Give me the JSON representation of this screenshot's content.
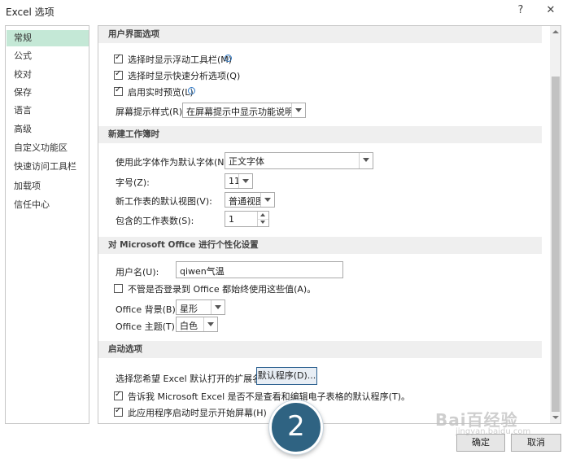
{
  "window": {
    "title": "Excel 选项",
    "help": "?",
    "close": "✕"
  },
  "sidebar": {
    "items": [
      {
        "label": "常规",
        "selected": true
      },
      {
        "label": "公式"
      },
      {
        "label": "校对"
      },
      {
        "label": "保存"
      },
      {
        "label": "语言"
      },
      {
        "label": "高级"
      },
      {
        "label": "自定义功能区"
      },
      {
        "label": "快速访问工具栏"
      },
      {
        "label": "加载项"
      },
      {
        "label": "信任中心"
      }
    ]
  },
  "ui_options": {
    "header": "用户界面选项",
    "show_mini_toolbar": {
      "label": "选择时显示浮动工具栏(M)",
      "checked": true
    },
    "show_quick_analysis": {
      "label": "选择时显示快速分析选项(Q)",
      "checked": true
    },
    "live_preview": {
      "label": "启用实时预览(L)",
      "checked": true
    },
    "screentip_style": {
      "label": "屏幕提示样式(R):",
      "value": "在屏幕提示中显示功能说明"
    }
  },
  "new_workbook": {
    "header": "新建工作簿时",
    "font": {
      "label": "使用此字体作为默认字体(N):",
      "value": "正文字体"
    },
    "font_size": {
      "label": "字号(Z):",
      "value": "11"
    },
    "default_view": {
      "label": "新工作表的默认视图(V):",
      "value": "普通视图"
    },
    "sheet_count": {
      "label": "包含的工作表数(S):",
      "value": "1"
    }
  },
  "personalize": {
    "header": "对 Microsoft Office 进行个性化设置",
    "username": {
      "label": "用户名(U):",
      "value": "qiwen气温"
    },
    "always_use": {
      "label": "不管是否登录到 Office 都始终使用这些值(A)。",
      "checked": false
    },
    "background": {
      "label": "Office 背景(B):",
      "value": "星形"
    },
    "theme": {
      "label": "Office 主题(T):",
      "value": "白色"
    }
  },
  "startup": {
    "header": "启动选项",
    "extensions_label": "选择您希望 Excel 默认打开的扩展名:",
    "default_programs_button": "默认程序(D)...",
    "tell_me_default": {
      "label": "告诉我 Microsoft Excel 是否不是查看和编辑电子表格的默认程序(T)。",
      "checked": true
    },
    "show_start_screen": {
      "label": "此应用程序启动时显示开始屏幕(H)",
      "checked": true
    }
  },
  "footer": {
    "ok": "确定",
    "cancel": "取消"
  },
  "overlay": {
    "step_number": "2",
    "watermark": "Bai百经验",
    "watermark_sub": "jingyan.baidu.com"
  }
}
